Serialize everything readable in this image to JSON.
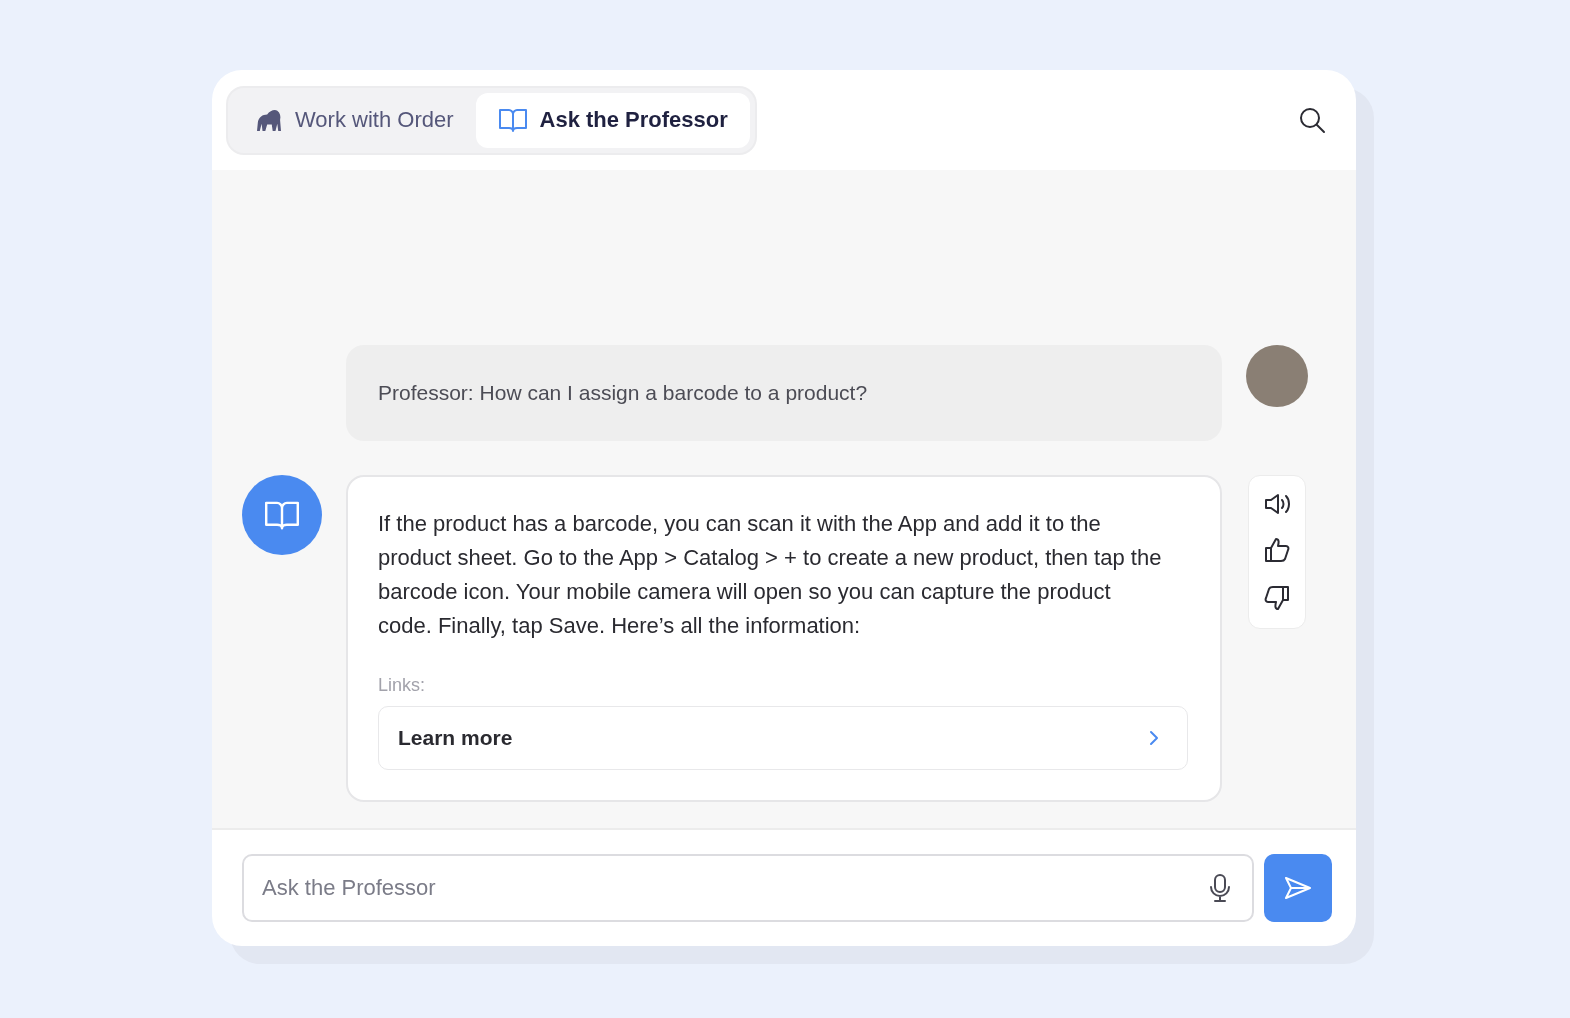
{
  "tabs": [
    {
      "label": "Work with Order",
      "kind": "gorilla",
      "selected": false
    },
    {
      "label": "Ask the Professor",
      "kind": "book",
      "selected": true
    }
  ],
  "messages": [
    {
      "kind": "user",
      "text": "Professor: How can I assign a barcode to a product?"
    },
    {
      "kind": "bot",
      "text": "If the product has a barcode, you can scan it with the App and add it to the product sheet. Go to the App > Catalog > + to create a new product, then tap the barcode icon. Your mobile camera will open so you can capture the product code. Finally, tap Save. Here’s all the information:",
      "links_label": "Links:",
      "links": [
        {
          "label": "Learn more"
        }
      ]
    }
  ],
  "composer": {
    "placeholder": "Ask the Professor"
  }
}
